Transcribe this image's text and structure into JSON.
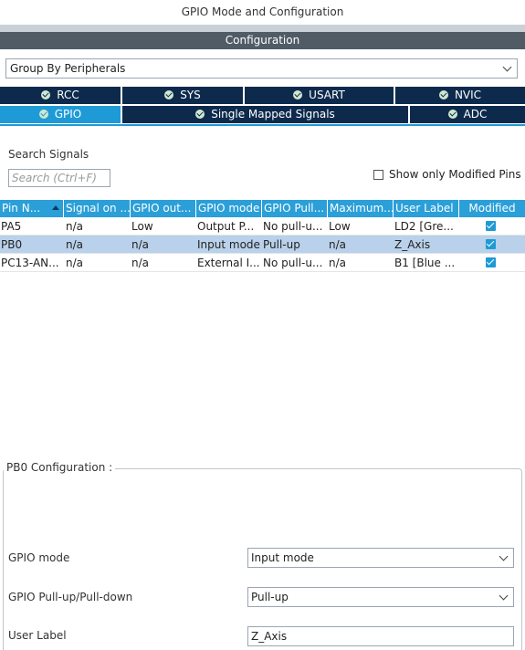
{
  "window": {
    "title": "GPIO Mode and Configuration"
  },
  "config_bar": {
    "label": "Configuration"
  },
  "group_by": {
    "value": "Group By Peripherals"
  },
  "tabs": [
    {
      "label": "RCC",
      "checked": true
    },
    {
      "label": "SYS",
      "checked": true
    },
    {
      "label": "USART",
      "checked": true
    },
    {
      "label": "NVIC",
      "checked": true
    },
    {
      "label": "GPIO",
      "checked": true,
      "active": true
    },
    {
      "label": "Single Mapped Signals",
      "checked": true
    },
    {
      "label": "ADC",
      "checked": true
    }
  ],
  "search": {
    "label": "Search Signals",
    "placeholder": "Search (Ctrl+F)"
  },
  "show_modified": {
    "label": "Show only Modified Pins",
    "checked": false
  },
  "table": {
    "headers": [
      "Pin N...",
      "Signal on ...",
      "GPIO out...",
      "GPIO mode",
      "GPIO Pull...",
      "Maximum...",
      "User Label",
      "Modified"
    ],
    "rows": [
      {
        "pin": "PA5",
        "signal": "n/a",
        "gpio_out": "Low",
        "gpio_mode": "Output P...",
        "pull": "No pull-u...",
        "max": "Low",
        "user_label": "LD2 [Gre...",
        "modified": true
      },
      {
        "pin": "PB0",
        "signal": "n/a",
        "gpio_out": "n/a",
        "gpio_mode": "Input mode",
        "pull": "Pull-up",
        "max": "n/a",
        "user_label": "Z_Axis",
        "modified": true,
        "selected": true
      },
      {
        "pin": "PC13-AN...",
        "signal": "n/a",
        "gpio_out": "n/a",
        "gpio_mode": "External I...",
        "pull": "No pull-u...",
        "max": "n/a",
        "user_label": "B1 [Blue ...",
        "modified": true
      }
    ]
  },
  "pin_config": {
    "title": "PB0 Configuration :",
    "gpio_mode_label": "GPIO mode",
    "gpio_mode_value": "Input mode",
    "pull_label": "GPIO Pull-up/Pull-down",
    "pull_value": "Pull-up",
    "user_label_label": "User Label",
    "user_label_value": "Z_Axis"
  },
  "colors": {
    "tab_dark": "#0d2a4d",
    "tab_active": "#1e9ad6",
    "header_blue": "#2a9fd8",
    "selected_row": "#b9d1ea",
    "config_bar": "#505b66"
  }
}
